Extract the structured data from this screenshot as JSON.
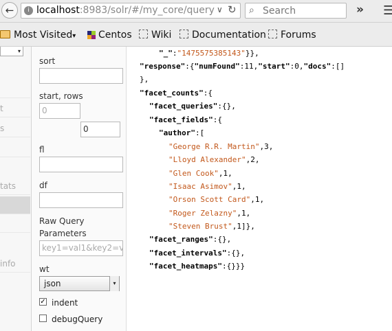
{
  "browser": {
    "url_host": "localhost",
    "url_rest": ":8983/solr/#/my_core/query",
    "search_placeholder": "Search",
    "overflow_glyph": "»",
    "menu_glyph": "☰",
    "back_glyph": "←",
    "reload_glyph": "↻",
    "url_chevron": "∨"
  },
  "bookmarks": [
    {
      "label": "Most Visited",
      "icon": "folder-icon",
      "chevron": "▾"
    },
    {
      "label": "Centos",
      "icon": "centos-icon"
    },
    {
      "label": "Wiki",
      "icon": "page-icon"
    },
    {
      "label": "Documentation",
      "icon": "page-icon"
    },
    {
      "label": "Forums",
      "icon": "page-icon"
    }
  ],
  "sidebar": {
    "core_select_chevron": "▾",
    "items": [
      {
        "label": "t"
      },
      {
        "label": "s"
      },
      {
        "label": ""
      },
      {
        "label": "tats"
      },
      {
        "label": ""
      },
      {
        "label": ""
      },
      {
        "label": "info"
      }
    ]
  },
  "form": {
    "sort_label": "sort",
    "sort_value": "",
    "start_rows_label": "start, rows",
    "start_placeholder": "0",
    "rows_value": "0",
    "fl_label": "fl",
    "fl_value": "",
    "df_label": "df",
    "df_value": "",
    "raw_query_label": "Raw Query",
    "parameters_label": "Parameters",
    "raw_placeholder": "key1=val1&key2=v",
    "wt_label": "wt",
    "wt_value": "json",
    "indent_label": "indent",
    "indent_checked": true,
    "debug_label": "debugQuery",
    "debug_checked": false
  },
  "result": {
    "line_underscore_key": "\"_\"",
    "line_underscore_val": "\"1475575385143\"",
    "response_key": "\"response\"",
    "numfound_key": "\"numFound\"",
    "numfound_val": "11",
    "start_key": "\"start\"",
    "start_val": "0",
    "docs_key": "\"docs\"",
    "facet_counts_key": "\"facet_counts\"",
    "facet_queries_key": "\"facet_queries\"",
    "facet_fields_key": "\"facet_fields\"",
    "author_key": "\"author\"",
    "authors": [
      {
        "name": "\"George R.R. Martin\"",
        "count": "3"
      },
      {
        "name": "\"Lloyd Alexander\"",
        "count": "2"
      },
      {
        "name": "\"Glen Cook\"",
        "count": "1"
      },
      {
        "name": "\"Isaac Asimov\"",
        "count": "1"
      },
      {
        "name": "\"Orson Scott Card\"",
        "count": "1"
      },
      {
        "name": "\"Roger Zelazny\"",
        "count": "1"
      },
      {
        "name": "\"Steven Brust\"",
        "count": "1"
      }
    ],
    "facet_ranges_key": "\"facet_ranges\"",
    "facet_intervals_key": "\"facet_intervals\"",
    "facet_heatmaps_key": "\"facet_heatmaps\""
  }
}
